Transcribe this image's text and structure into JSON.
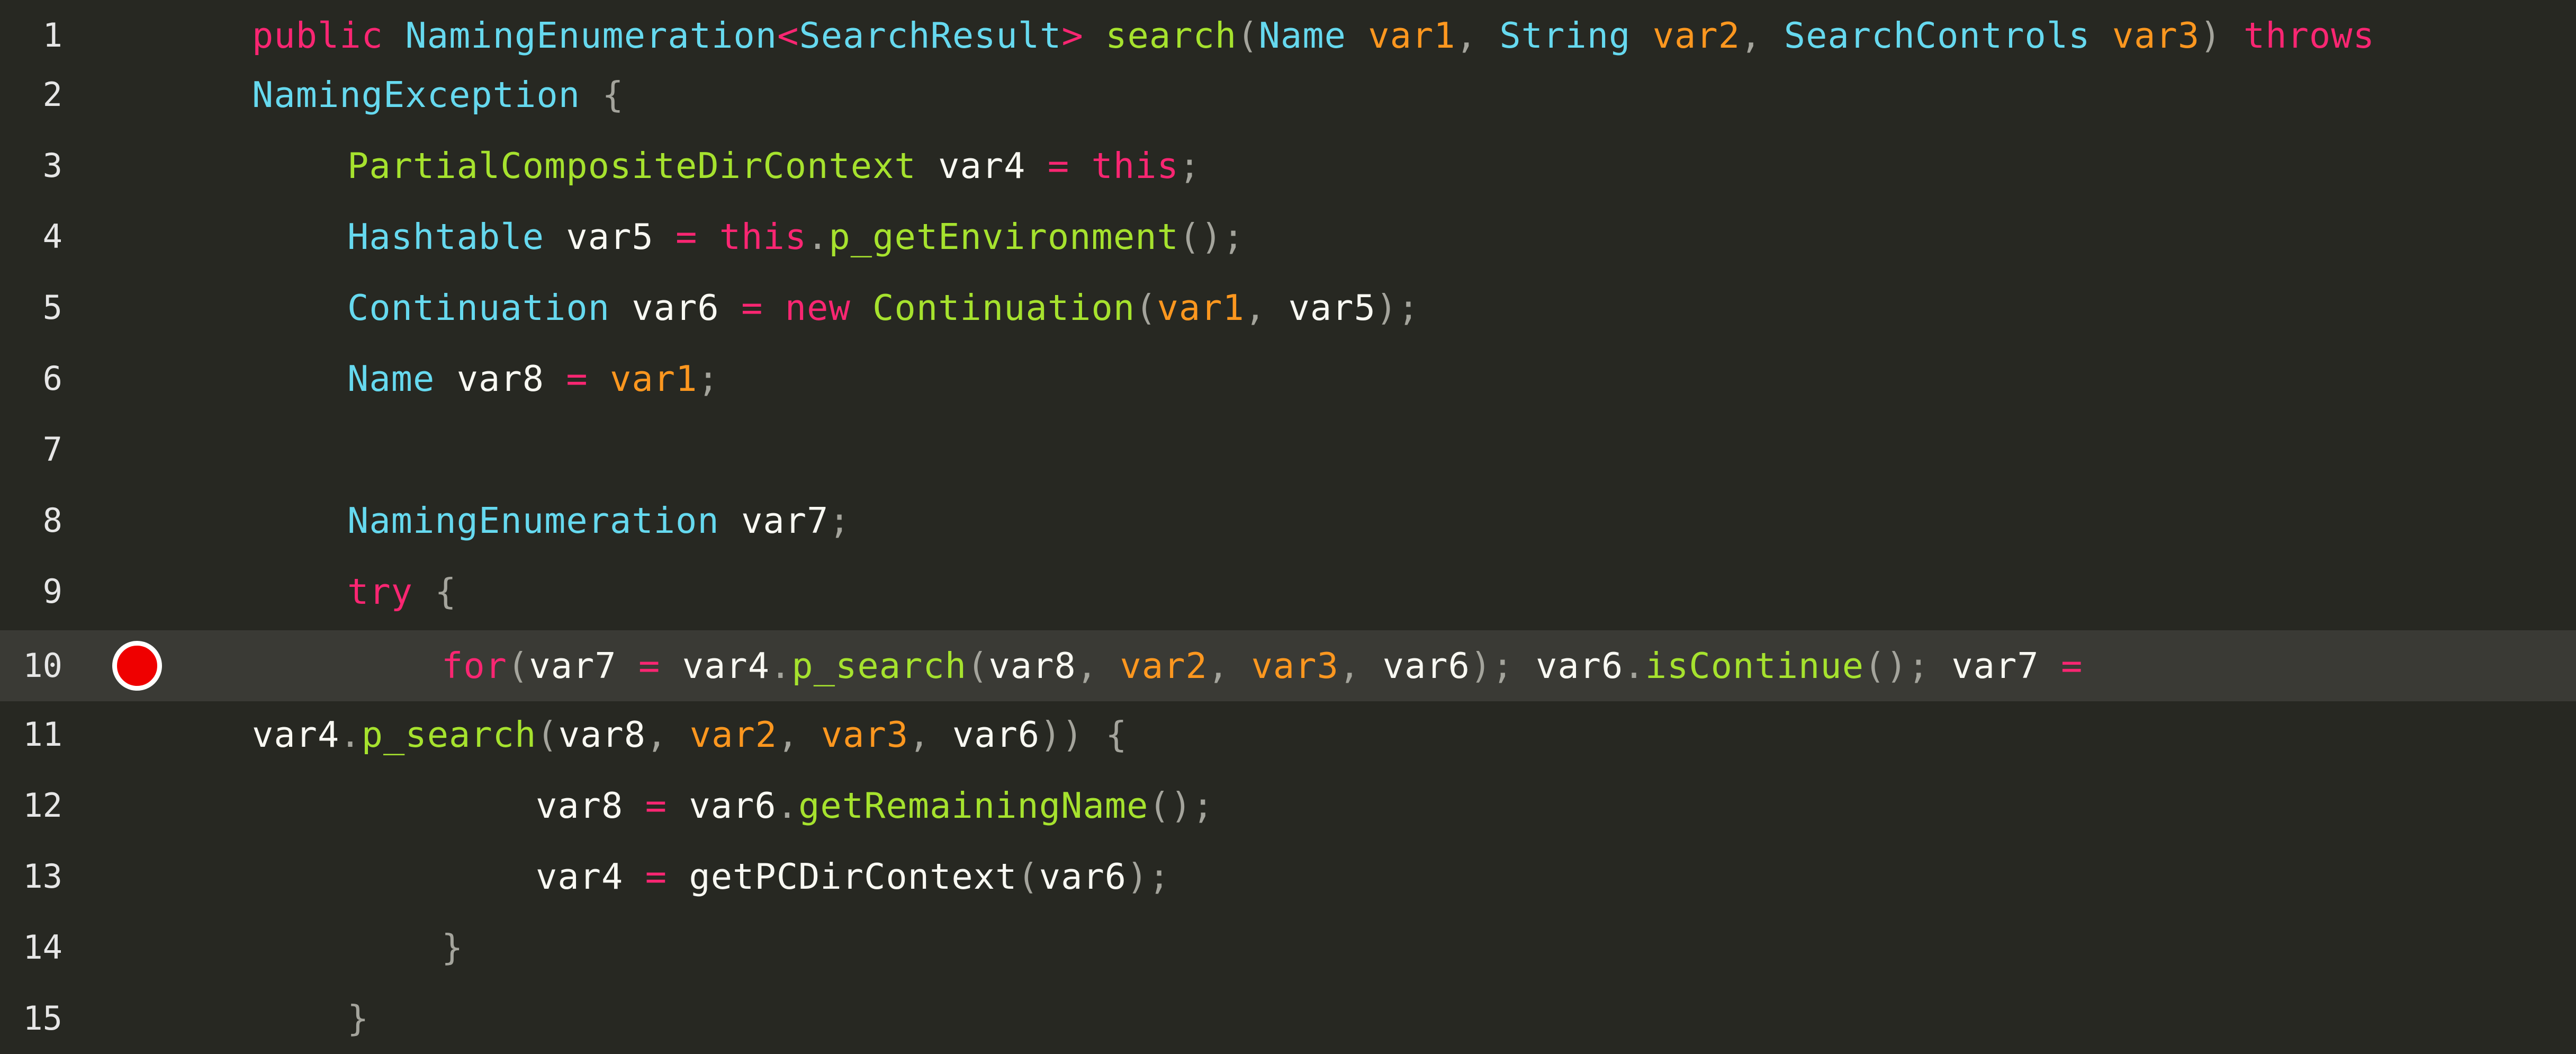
{
  "editor": {
    "colors": {
      "background": "#272822",
      "current_line": "#3a3a35",
      "keyword": "#f92672",
      "type": "#66d9ef",
      "function": "#a6e22e",
      "parameter": "#fd971f",
      "text": "#f8f8f2",
      "punctuation": "#a4a49c",
      "breakpoint": "#ef0000"
    },
    "breakpoint_icon": "breakpoint-icon",
    "breakpoint_line": 10,
    "lines": [
      {
        "num": "1",
        "tokens": [
          {
            "text": "public",
            "cls": "k"
          },
          {
            "text": " ",
            "cls": "v"
          },
          {
            "text": "NamingEnumeration",
            "cls": "t"
          },
          {
            "text": "<",
            "cls": "k"
          },
          {
            "text": "SearchResult",
            "cls": "t"
          },
          {
            "text": ">",
            "cls": "k"
          },
          {
            "text": " ",
            "cls": "v"
          },
          {
            "text": "search",
            "cls": "f"
          },
          {
            "text": "(",
            "cls": "o"
          },
          {
            "text": "Name",
            "cls": "t"
          },
          {
            "text": " ",
            "cls": "v"
          },
          {
            "text": "var1",
            "cls": "p"
          },
          {
            "text": ", ",
            "cls": "o"
          },
          {
            "text": "String",
            "cls": "t"
          },
          {
            "text": " ",
            "cls": "v"
          },
          {
            "text": "var2",
            "cls": "p"
          },
          {
            "text": ", ",
            "cls": "o"
          },
          {
            "text": "SearchControls",
            "cls": "t"
          },
          {
            "text": " ",
            "cls": "v"
          },
          {
            "text": "var3",
            "cls": "p"
          },
          {
            "text": ") ",
            "cls": "o"
          },
          {
            "text": "throws",
            "cls": "k"
          }
        ]
      },
      {
        "num": "2",
        "tokens": [
          {
            "text": "NamingException",
            "cls": "t"
          },
          {
            "text": " {",
            "cls": "o"
          }
        ]
      },
      {
        "num": "3",
        "tokens": [
          {
            "text": "PartialCompositeDirContext",
            "cls": "f"
          },
          {
            "text": " var4 ",
            "cls": "v"
          },
          {
            "text": "=",
            "cls": "k"
          },
          {
            "text": " ",
            "cls": "v"
          },
          {
            "text": "this",
            "cls": "k"
          },
          {
            "text": ";",
            "cls": "o"
          }
        ]
      },
      {
        "num": "4",
        "tokens": [
          {
            "text": "Hashtable",
            "cls": "t"
          },
          {
            "text": " var5 ",
            "cls": "v"
          },
          {
            "text": "=",
            "cls": "k"
          },
          {
            "text": " ",
            "cls": "v"
          },
          {
            "text": "this",
            "cls": "k"
          },
          {
            "text": ".",
            "cls": "o"
          },
          {
            "text": "p_getEnvironment",
            "cls": "f"
          },
          {
            "text": "();",
            "cls": "o"
          }
        ]
      },
      {
        "num": "5",
        "tokens": [
          {
            "text": "Continuation",
            "cls": "t"
          },
          {
            "text": " var6 ",
            "cls": "v"
          },
          {
            "text": "=",
            "cls": "k"
          },
          {
            "text": " ",
            "cls": "v"
          },
          {
            "text": "new",
            "cls": "k"
          },
          {
            "text": " ",
            "cls": "v"
          },
          {
            "text": "Continuation",
            "cls": "f"
          },
          {
            "text": "(",
            "cls": "o"
          },
          {
            "text": "var1",
            "cls": "p"
          },
          {
            "text": ", ",
            "cls": "o"
          },
          {
            "text": "var5",
            "cls": "v"
          },
          {
            "text": ");",
            "cls": "o"
          }
        ]
      },
      {
        "num": "6",
        "tokens": [
          {
            "text": "Name",
            "cls": "t"
          },
          {
            "text": " var8 ",
            "cls": "v"
          },
          {
            "text": "=",
            "cls": "k"
          },
          {
            "text": " ",
            "cls": "v"
          },
          {
            "text": "var1",
            "cls": "p"
          },
          {
            "text": ";",
            "cls": "o"
          }
        ]
      },
      {
        "num": "7",
        "tokens": []
      },
      {
        "num": "8",
        "tokens": [
          {
            "text": "NamingEnumeration",
            "cls": "t"
          },
          {
            "text": " var7",
            "cls": "v"
          },
          {
            "text": ";",
            "cls": "o"
          }
        ]
      },
      {
        "num": "9",
        "tokens": [
          {
            "text": "try",
            "cls": "k"
          },
          {
            "text": " {",
            "cls": "o"
          }
        ]
      },
      {
        "num": "10",
        "tokens": [
          {
            "text": "for",
            "cls": "k"
          },
          {
            "text": "(",
            "cls": "o"
          },
          {
            "text": "var7 ",
            "cls": "v"
          },
          {
            "text": "=",
            "cls": "k"
          },
          {
            "text": " var4",
            "cls": "v"
          },
          {
            "text": ".",
            "cls": "o"
          },
          {
            "text": "p_search",
            "cls": "f"
          },
          {
            "text": "(",
            "cls": "o"
          },
          {
            "text": "var8",
            "cls": "v"
          },
          {
            "text": ", ",
            "cls": "o"
          },
          {
            "text": "var2",
            "cls": "p"
          },
          {
            "text": ", ",
            "cls": "o"
          },
          {
            "text": "var3",
            "cls": "p"
          },
          {
            "text": ", ",
            "cls": "o"
          },
          {
            "text": "var6",
            "cls": "v"
          },
          {
            "text": "); ",
            "cls": "o"
          },
          {
            "text": "var6",
            "cls": "v"
          },
          {
            "text": ".",
            "cls": "o"
          },
          {
            "text": "isContinue",
            "cls": "f"
          },
          {
            "text": "(); ",
            "cls": "o"
          },
          {
            "text": "var7 ",
            "cls": "v"
          },
          {
            "text": "=",
            "cls": "k"
          }
        ]
      },
      {
        "num": "11",
        "tokens": [
          {
            "text": "var4",
            "cls": "v"
          },
          {
            "text": ".",
            "cls": "o"
          },
          {
            "text": "p_search",
            "cls": "f"
          },
          {
            "text": "(",
            "cls": "o"
          },
          {
            "text": "var8",
            "cls": "v"
          },
          {
            "text": ", ",
            "cls": "o"
          },
          {
            "text": "var2",
            "cls": "p"
          },
          {
            "text": ", ",
            "cls": "o"
          },
          {
            "text": "var3",
            "cls": "p"
          },
          {
            "text": ", ",
            "cls": "o"
          },
          {
            "text": "var6",
            "cls": "v"
          },
          {
            "text": ")) {",
            "cls": "o"
          }
        ]
      },
      {
        "num": "12",
        "tokens": [
          {
            "text": "var8 ",
            "cls": "v"
          },
          {
            "text": "=",
            "cls": "k"
          },
          {
            "text": " var6",
            "cls": "v"
          },
          {
            "text": ".",
            "cls": "o"
          },
          {
            "text": "getRemainingName",
            "cls": "f"
          },
          {
            "text": "();",
            "cls": "o"
          }
        ]
      },
      {
        "num": "13",
        "tokens": [
          {
            "text": "var4 ",
            "cls": "v"
          },
          {
            "text": "=",
            "cls": "k"
          },
          {
            "text": " getPCDirContext",
            "cls": "v"
          },
          {
            "text": "(",
            "cls": "o"
          },
          {
            "text": "var6",
            "cls": "v"
          },
          {
            "text": ");",
            "cls": "o"
          }
        ]
      },
      {
        "num": "14",
        "tokens": [
          {
            "text": "}",
            "cls": "o"
          }
        ]
      },
      {
        "num": "15",
        "tokens": [
          {
            "text": "}",
            "cls": "o"
          }
        ]
      }
    ]
  }
}
